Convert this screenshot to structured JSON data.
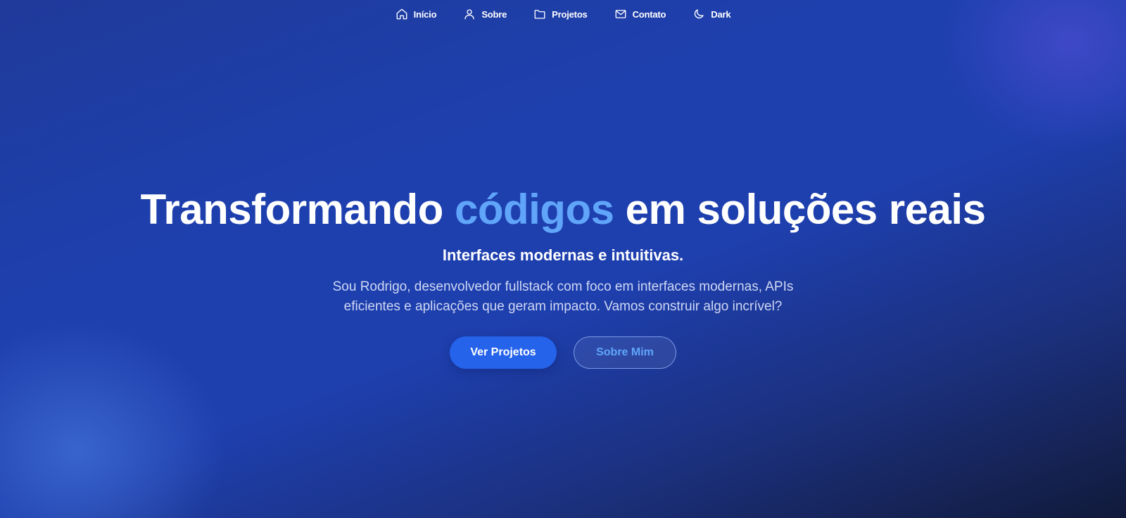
{
  "nav": {
    "items": [
      {
        "label": "Início",
        "icon": "home-icon"
      },
      {
        "label": "Sobre",
        "icon": "user-icon"
      },
      {
        "label": "Projetos",
        "icon": "folder-icon"
      },
      {
        "label": "Contato",
        "icon": "mail-icon"
      },
      {
        "label": "Dark",
        "icon": "moon-icon"
      }
    ]
  },
  "hero": {
    "headline_part1": "Transformando ",
    "headline_accent": "códigos",
    "headline_part2": " em soluções reais",
    "subtitle": "Interfaces modernas e intuitivas.",
    "description": "Sou Rodrigo, desenvolvedor fullstack com foco em interfaces modernas, APIs eficientes e aplicações que geram impacto. Vamos construir algo incrível?",
    "primary_button": "Ver Projetos",
    "secondary_button": "Sobre Mim"
  },
  "colors": {
    "accent": "#60a5fa",
    "primary_button": "#2563eb",
    "background_top": "#1e40af",
    "background_bottom": "#111a3a"
  }
}
